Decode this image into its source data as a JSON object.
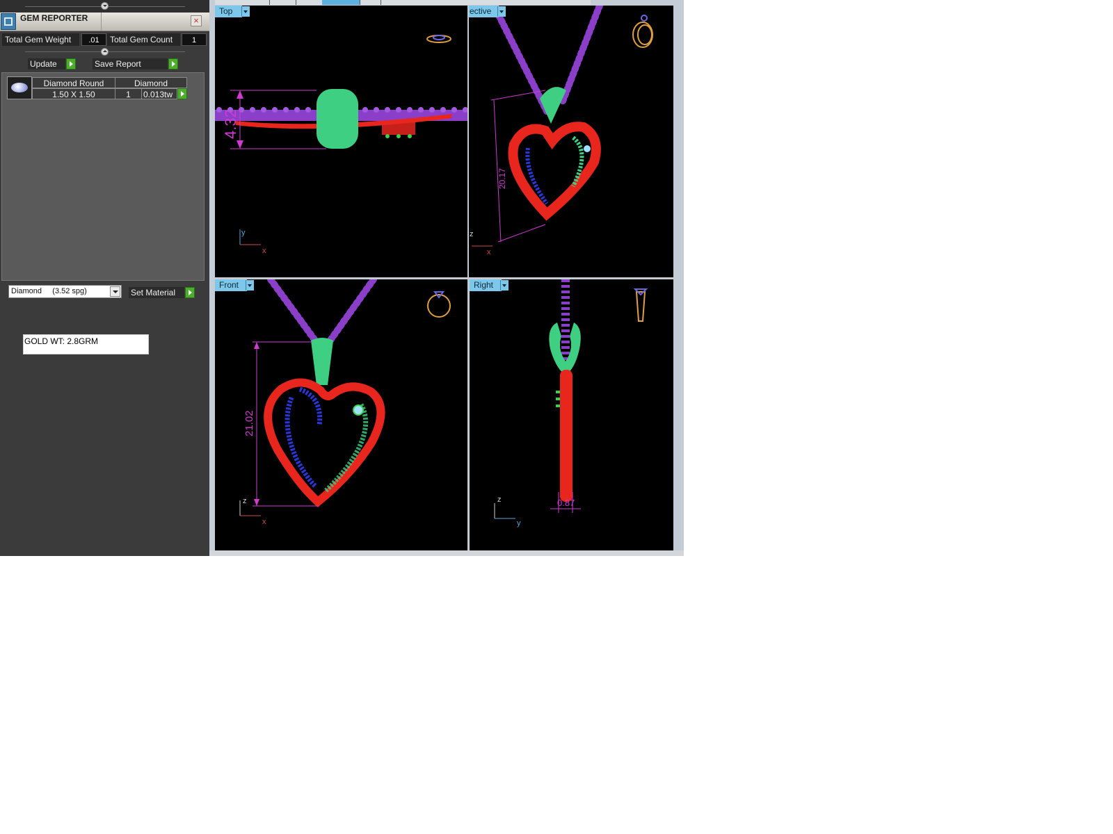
{
  "panel": {
    "title": "GEM REPORTER",
    "close_symbol": "×",
    "total_weight_label": "Total Gem Weight",
    "total_weight_value": ".01",
    "total_count_label": "Total Gem Count",
    "total_count_value": "1",
    "update_label": "Update",
    "save_report_label": "Save Report",
    "gem_row": {
      "name": "Diamond Round",
      "material": "Diamond",
      "size": "1.50 X 1.50",
      "count": "1",
      "weight": "0.013tw"
    },
    "material_select_value": "Diamond     (3.52 spg)",
    "set_material_label": "Set Material",
    "gold_note": "GOLD WT: 2.8GRM"
  },
  "viewports": {
    "top": {
      "label": "Top",
      "dimension": "4.32",
      "axes": [
        "y",
        "x"
      ]
    },
    "perspective": {
      "label": "ective",
      "dimension": "20.17",
      "axes": [
        "z",
        "x"
      ]
    },
    "front": {
      "label": "Front",
      "dimension": "21.02",
      "axes": [
        "z",
        "x"
      ]
    },
    "right": {
      "label": "Right",
      "dimension": "0.87",
      "axes": [
        "z",
        "y"
      ]
    }
  },
  "colors": {
    "viewport_label_bg": "#7cc7ea",
    "metal_red": "#e8261e",
    "bail_green": "#3ecf83",
    "chain_purple": "#8b3fc9",
    "pave_blue": "#2a37d8",
    "dimension_magenta": "#d03bd0",
    "button_green": "#4cae2c"
  }
}
